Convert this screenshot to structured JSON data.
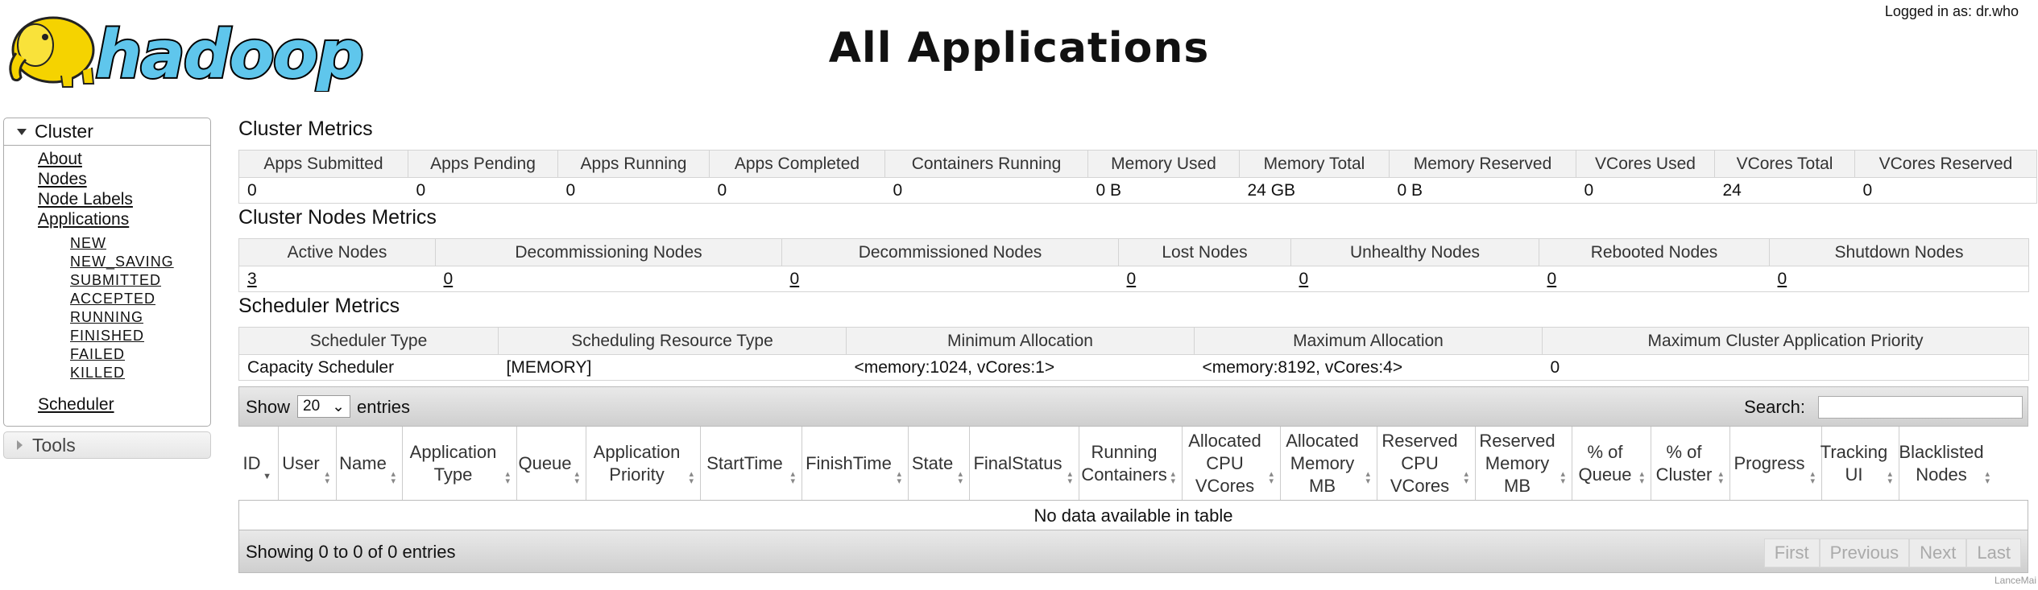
{
  "header": {
    "logo_text": "hadoop",
    "title": "All Applications",
    "login": "Logged in as: dr.who"
  },
  "nav": {
    "cluster_label": "Cluster",
    "links": [
      "About",
      "Nodes",
      "Node Labels",
      "Applications"
    ],
    "app_states": [
      "NEW",
      "NEW_SAVING",
      "SUBMITTED",
      "ACCEPTED",
      "RUNNING",
      "FINISHED",
      "FAILED",
      "KILLED"
    ],
    "scheduler": "Scheduler",
    "tools_label": "Tools"
  },
  "cluster_metrics": {
    "title": "Cluster Metrics",
    "headers": [
      "Apps Submitted",
      "Apps Pending",
      "Apps Running",
      "Apps Completed",
      "Containers Running",
      "Memory Used",
      "Memory Total",
      "Memory Reserved",
      "VCores Used",
      "VCores Total",
      "VCores Reserved"
    ],
    "values": [
      "0",
      "0",
      "0",
      "0",
      "0",
      "0 B",
      "24 GB",
      "0 B",
      "0",
      "24",
      "0"
    ]
  },
  "node_metrics": {
    "title": "Cluster Nodes Metrics",
    "headers": [
      "Active Nodes",
      "Decommissioning Nodes",
      "Decommissioned Nodes",
      "Lost Nodes",
      "Unhealthy Nodes",
      "Rebooted Nodes",
      "Shutdown Nodes"
    ],
    "values": [
      "3",
      "0",
      "0",
      "0",
      "0",
      "0",
      "0"
    ]
  },
  "scheduler_metrics": {
    "title": "Scheduler Metrics",
    "headers": [
      "Scheduler Type",
      "Scheduling Resource Type",
      "Minimum Allocation",
      "Maximum Allocation",
      "Maximum Cluster Application Priority"
    ],
    "values": [
      "Capacity Scheduler",
      "[MEMORY]",
      "<memory:1024, vCores:1>",
      "<memory:8192, vCores:4>",
      "0"
    ]
  },
  "apps_table": {
    "show_label": "Show",
    "page_size": "20",
    "entries_label": "entries",
    "search_label": "Search:",
    "search_value": "",
    "columns": [
      "ID",
      "User",
      "Name",
      "Application Type",
      "Queue",
      "Application Priority",
      "StartTime",
      "FinishTime",
      "State",
      "FinalStatus",
      "Running Containers",
      "Allocated CPU VCores",
      "Allocated Memory MB",
      "Reserved CPU VCores",
      "Reserved Memory MB",
      "% of Queue",
      "% of Cluster",
      "Progress",
      "Tracking UI",
      "Blacklisted Nodes"
    ],
    "empty_message": "No data available in table",
    "info": "Showing 0 to 0 of 0 entries",
    "pagination": [
      "First",
      "Previous",
      "Next",
      "Last"
    ]
  },
  "watermark": "LanceMai"
}
